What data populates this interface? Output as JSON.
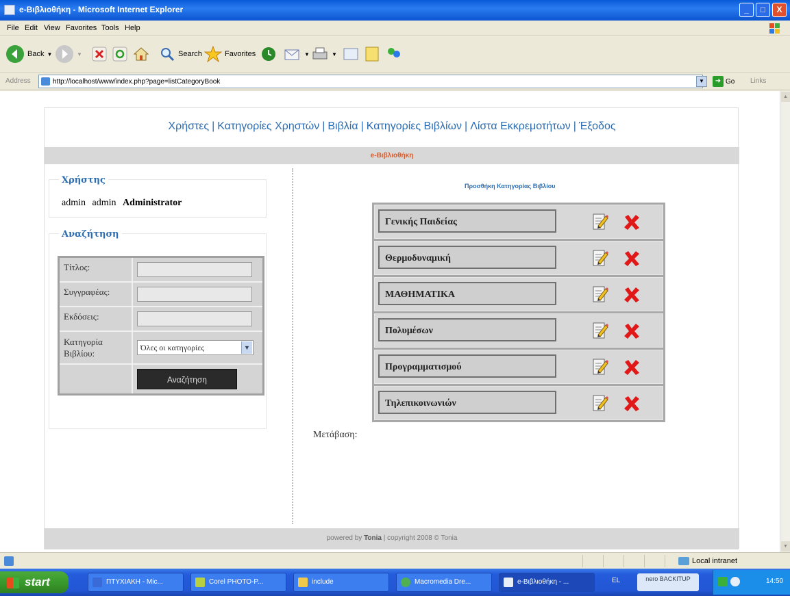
{
  "window": {
    "title": "e-Βιβλιοθήκη - Microsoft Internet Explorer",
    "min_label": "_",
    "max_label": "□",
    "close_label": "X"
  },
  "menu": [
    "File",
    "Edit",
    "View",
    "Favorites",
    "Tools",
    "Help"
  ],
  "toolbar": {
    "back_label": "Back",
    "search_label": "Search",
    "favorites_label": "Favorites"
  },
  "address": {
    "label": "Address",
    "url": "http://localhost/www/index.php?page=listCategoryBook",
    "go_label": "Go",
    "links_label": "Links"
  },
  "page": {
    "nav": [
      "Χρήστες",
      "Κατηγορίες Χρηστών",
      "Βιβλία",
      "Κατηγορίες Βιβλίων",
      "Λίστα Εκκρεμοτήτων",
      "Έξοδος"
    ],
    "band_title": "e-Βιβλιοθήκη",
    "user_box": {
      "legend": "Χρήστης",
      "first": "admin",
      "last": "admin",
      "role": "Administrator"
    },
    "search_box": {
      "legend": "Αναζήτηση",
      "title_label": "Τίτλος:",
      "author_label": "Συγγραφέας:",
      "publisher_label": "Εκδόσεις:",
      "category_label": "Κατηγορία Βιβλίου:",
      "category_value": "Όλες οι κατηγορίες",
      "search_button": "Αναζήτηση"
    },
    "add_category_link": "Προσθήκη Κατηγορίας Βιβλίου",
    "categories": [
      "Γενικής Παιδείας",
      "Θερμοδυναμική",
      "ΜΑΘΗΜΑΤΙΚΑ",
      "Πολυμέσων",
      "Προγραμματισμού",
      "Τηλεπικοινωνιών"
    ],
    "pagination_label": "Μετάβαση:",
    "footer": {
      "powered": "powered by",
      "author": "Tonia",
      "copyright": "| copyright 2008 © Tonia"
    }
  },
  "status": {
    "zone": "Local intranet"
  },
  "taskbar": {
    "start_label": "start",
    "tasks": [
      "ΠΤΥΧΙΑΚΗ - Mic...",
      "Corel PHOTO-P...",
      "include",
      "Macromedia Dre...",
      "e-Βιβλιοθήκη - ..."
    ],
    "language": "EL",
    "nero": "nero BACKITUP",
    "clock": "14:50"
  },
  "colors": {
    "link_blue": "#2c6cb0",
    "band_orange": "#d85c2c",
    "delete_red": "#e01818"
  }
}
